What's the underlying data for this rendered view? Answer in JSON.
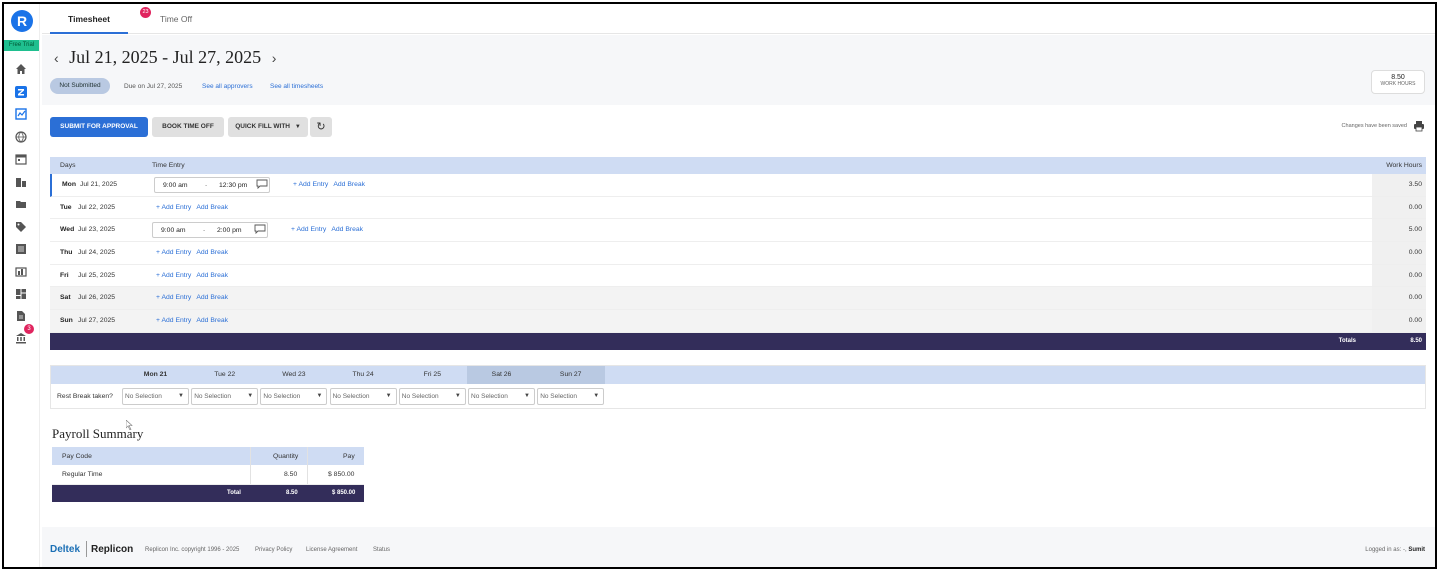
{
  "app": {
    "logo_letter": "R",
    "free_trial": "Free Trial",
    "nav_badge": "3"
  },
  "tabs": [
    {
      "label": "Timesheet",
      "badge": "23"
    },
    {
      "label": "Time Off"
    }
  ],
  "header": {
    "date_range": "Jul 21, 2025 - Jul 27, 2025",
    "prev": "‹",
    "next": "›",
    "status": "Not Submitted",
    "due": "Due on Jul 27, 2025",
    "link_approvers": "See all approvers",
    "link_timesheets": "See all timesheets",
    "work_hours_value": "8.50",
    "work_hours_label": "WORK HOURS"
  },
  "toolbar": {
    "submit": "SUBMIT FOR APPROVAL",
    "book_time_off": "BOOK TIME OFF",
    "quick_fill": "QUICK FILL WITH",
    "refresh": "↻",
    "saved_text": "Changes have been saved"
  },
  "time_table": {
    "col_days": "Days",
    "col_entry": "Time Entry",
    "col_hours": "Work Hours",
    "add_entry": "+ Add Entry",
    "add_break": "Add Break",
    "rows": [
      {
        "day": "Mon",
        "date": "Jul 21, 2025",
        "start": "9:00 am",
        "end": "12:30 pm",
        "hours": "3.50"
      },
      {
        "day": "Tue",
        "date": "Jul 22, 2025",
        "hours": "0.00"
      },
      {
        "day": "Wed",
        "date": "Jul 23, 2025",
        "start": "9:00 am",
        "end": "2:00 pm",
        "hours": "5.00"
      },
      {
        "day": "Thu",
        "date": "Jul 24, 2025",
        "hours": "0.00"
      },
      {
        "day": "Fri",
        "date": "Jul 25, 2025",
        "hours": "0.00"
      },
      {
        "day": "Sat",
        "date": "Jul 26, 2025",
        "hours": "0.00"
      },
      {
        "day": "Sun",
        "date": "Jul 27, 2025",
        "hours": "0.00"
      }
    ],
    "totals_label": "Totals",
    "totals_value": "8.50",
    "dash": "-"
  },
  "rest_break": {
    "label": "Rest Break taken?",
    "days": [
      "Mon 21",
      "Tue 22",
      "Wed 23",
      "Thu 24",
      "Fri 25",
      "Sat 26",
      "Sun 27"
    ],
    "selection": "No Selection"
  },
  "payroll": {
    "title": "Payroll Summary",
    "col_pay_code": "Pay Code",
    "col_quantity": "Quantity",
    "col_pay": "Pay",
    "row_code": "Regular Time",
    "row_qty": "8.50",
    "row_pay": "$ 850.00",
    "total_label": "Total",
    "total_qty": "8.50",
    "total_pay": "$ 850.00"
  },
  "footer": {
    "deltek": "Deltek",
    "replicon": "Replicon",
    "copyright": "Replicon Inc. copyright 1996 - 2025",
    "privacy": "Privacy Policy",
    "license": "License Agreement",
    "status": "Status",
    "logged_in": "Logged in as: -,",
    "user": "Sumit"
  }
}
